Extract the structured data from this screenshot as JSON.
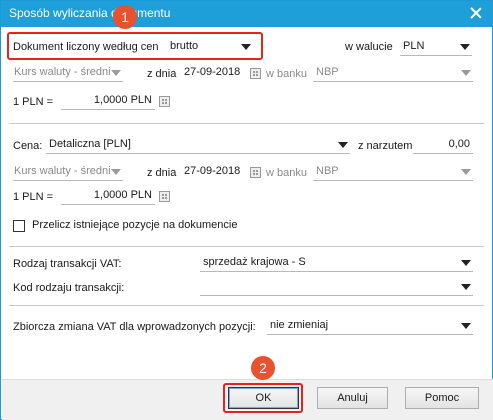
{
  "window": {
    "title": "Sposób wyliczania dokumentu"
  },
  "top": {
    "doc_label": "Dokument liczony według cen",
    "doc_value": "brutto",
    "currency_label": "w walucie",
    "currency_value": "PLN",
    "rate_type": "Kurs waluty - średni",
    "date_label": "z dnia",
    "date_value": "27-09-2018",
    "bank_label": "w banku",
    "bank_value": "NBP",
    "rate_left": "1 PLN =",
    "rate_value": "1,0000 PLN"
  },
  "price": {
    "label": "Cena:",
    "value": "Detaliczna [PLN]",
    "markup_label": "z narzutem",
    "markup_value": "0,00",
    "rate_type": "Kurs waluty - średni",
    "date_label": "z dnia",
    "date_value": "27-09-2018",
    "bank_label": "w banku",
    "bank_value": "NBP",
    "rate_left": "1 PLN =",
    "rate_value": "1,0000 PLN"
  },
  "recalc": {
    "label": "Przelicz istniejące pozycje na dokumencie",
    "checked": false
  },
  "vat": {
    "transaction_label": "Rodzaj transakcji VAT:",
    "transaction_value": "sprzedaż krajowa - S",
    "code_label": "Kod rodzaju transakcji:",
    "code_value": "",
    "change_label": "Zbiorcza zmiana VAT dla wprowadzonych pozycji:",
    "change_value": "nie zmieniaj"
  },
  "buttons": {
    "ok": "OK",
    "cancel": "Anuluj",
    "help": "Pomoc"
  },
  "annotations": {
    "badge1": "1",
    "badge2": "2",
    "color": "#e52420"
  }
}
